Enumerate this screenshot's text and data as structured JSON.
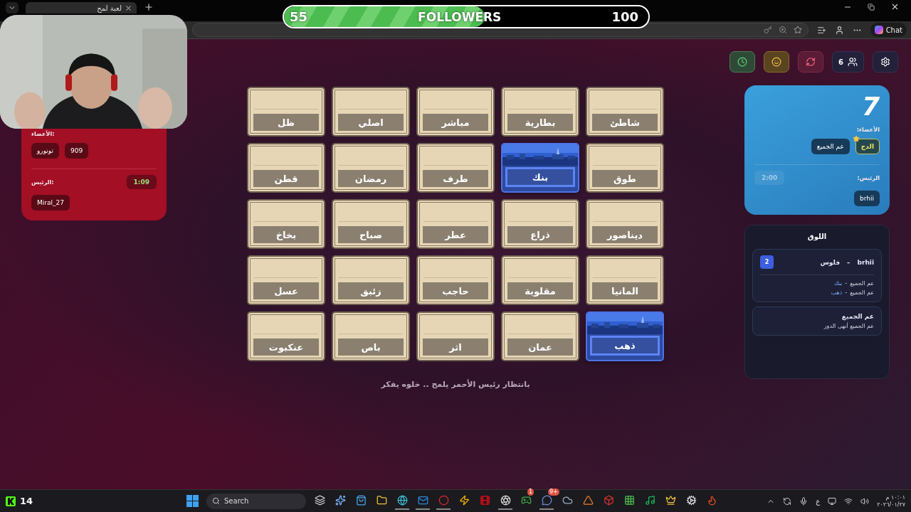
{
  "browser": {
    "tab_title": "لعبة لمح",
    "chat_button": "Chat"
  },
  "stream_overlay": {
    "followers": {
      "current": "55",
      "label": "FOLLOWERS",
      "goal": "100",
      "level": 0.55
    }
  },
  "red_team": {
    "kind": "red",
    "members_label": "الأعضاء:",
    "members": [
      {
        "name": "909",
        "starred": false
      },
      {
        "name": "تونورو",
        "starred": false
      }
    ],
    "leader_label": "الرئيس:",
    "timer": "1:09",
    "timer_active": true,
    "leader": "Miral_27"
  },
  "board": {
    "cards": [
      {
        "word": "شاطئ",
        "revealed": false
      },
      {
        "word": "بطارية",
        "revealed": false
      },
      {
        "word": "مباشر",
        "revealed": false
      },
      {
        "word": "اصلي",
        "revealed": false
      },
      {
        "word": "ظل",
        "revealed": false
      },
      {
        "word": "طوق",
        "revealed": false
      },
      {
        "word": "بنك",
        "revealed": true
      },
      {
        "word": "طرف",
        "revealed": false
      },
      {
        "word": "رمضان",
        "revealed": false
      },
      {
        "word": "قطن",
        "revealed": false
      },
      {
        "word": "ديناصور",
        "revealed": false
      },
      {
        "word": "ذراع",
        "revealed": false
      },
      {
        "word": "عطر",
        "revealed": false
      },
      {
        "word": "صباح",
        "revealed": false
      },
      {
        "word": "بخاخ",
        "revealed": false
      },
      {
        "word": "المانيا",
        "revealed": false
      },
      {
        "word": "مقلوبة",
        "revealed": false
      },
      {
        "word": "حاجب",
        "revealed": false
      },
      {
        "word": "زئبق",
        "revealed": false
      },
      {
        "word": "عسل",
        "revealed": false
      },
      {
        "word": "ذهب",
        "revealed": true
      },
      {
        "word": "عمان",
        "revealed": false
      },
      {
        "word": "اثر",
        "revealed": false
      },
      {
        "word": "باص",
        "revealed": false
      },
      {
        "word": "عنكبوت",
        "revealed": false
      }
    ],
    "status": "بانتظار رئيس الأحمر يلمح .. خلوه يفكر"
  },
  "toolbar": [
    {
      "kind": "timer"
    },
    {
      "kind": "emoji"
    },
    {
      "kind": "refresh"
    },
    {
      "kind": "players",
      "count": "6"
    },
    {
      "kind": "settings"
    }
  ],
  "blue_team": {
    "kind": "blue",
    "score": "7",
    "members_label": "الأعضاء:",
    "members": [
      {
        "name": "الدح",
        "starred": true
      },
      {
        "name": "عم الجميع",
        "starred": false
      }
    ],
    "leader_label": "الرئيس:",
    "timer": "2:00",
    "timer_active": false,
    "leader": "brhii"
  },
  "log": {
    "title": "اللوق",
    "entries": [
      {
        "kind": "clue",
        "player": "brhii",
        "dash": "–",
        "word": "فلوس",
        "count": "2",
        "guesses": [
          {
            "player": "عم الجميع",
            "separator": "-",
            "word": "بنك"
          },
          {
            "player": "عم الجميع",
            "separator": "-",
            "word": "ذهب"
          }
        ]
      },
      {
        "kind": "turn_end",
        "player": "عم الجميع",
        "message": "عم الجميع أنهى الدور"
      }
    ]
  },
  "taskbar": {
    "kick_count": "14",
    "search_placeholder": "Search",
    "apps": [
      {
        "kind": "taskview",
        "running": false
      },
      {
        "kind": "copilot",
        "running": false
      },
      {
        "kind": "store",
        "running": false
      },
      {
        "kind": "files",
        "running": false
      },
      {
        "kind": "edge",
        "running": true
      },
      {
        "kind": "mail",
        "running": true
      },
      {
        "kind": "opera",
        "running": true
      },
      {
        "kind": "zap",
        "running": false
      },
      {
        "kind": "film",
        "running": false
      },
      {
        "kind": "aperture",
        "running": true
      },
      {
        "kind": "xbox",
        "running": false
      },
      {
        "kind": "chat",
        "running": true
      },
      {
        "kind": "cloud",
        "running": false
      },
      {
        "kind": "triangle",
        "running": false
      },
      {
        "kind": "box",
        "running": false
      },
      {
        "kind": "grid",
        "running": false
      },
      {
        "kind": "music",
        "running": false
      },
      {
        "kind": "crown",
        "running": false
      },
      {
        "kind": "cog",
        "running": false
      },
      {
        "kind": "flame",
        "running": false
      }
    ],
    "app_badges": {
      "xbox": "1",
      "chat": "9+"
    },
    "tray": {
      "language": "ع",
      "time": "١٠:٠١ م",
      "date": "٢٠٢٦/٠١/٢٧"
    }
  }
}
